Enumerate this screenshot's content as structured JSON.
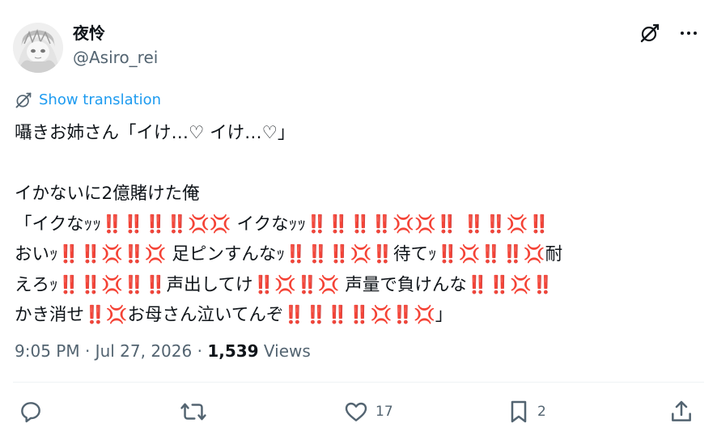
{
  "author": {
    "display_name": "夜怜",
    "handle": "@Asiro_rei"
  },
  "translation": {
    "label": "Show translation"
  },
  "tweet": {
    "lines": [
      "囁きお姉さん「イけ…♡ イけ…♡」",
      "",
      "イかないに2億賭けた俺",
      "「イクなｯｯ‼️‼️‼️‼️💢💢 イクなｯｯ‼️‼️‼️‼️💢💢‼️ ‼️‼️💢‼️",
      "おいｯ‼️‼️💢‼️💢 足ピンすんなｯ‼️‼️‼️💢‼️待てｯ‼️💢‼️‼️💢耐",
      "えろｯ‼️‼️💢‼️‼️声出してけ‼️💢‼️💢 声量で負けんな‼️‼️💢‼️",
      "かき消せ‼️💢お母さん泣いてんぞ‼️‼️‼️‼️💢‼️💢」"
    ]
  },
  "meta": {
    "time": "9:05 PM",
    "sep1": " · ",
    "date": "Jul 27, 2026",
    "sep2": " · ",
    "views_count": "1,539",
    "views_label": " Views"
  },
  "actions": {
    "reply_count": "",
    "repost_count": "",
    "like_count": "17",
    "bookmark_count": "2"
  },
  "icons": {
    "grok": "grok-icon",
    "more": "more-dots-icon",
    "translate": "translate-icon",
    "reply": "reply-icon",
    "repost": "repost-icon",
    "like": "heart-icon",
    "bookmark": "bookmark-icon",
    "share": "share-icon"
  },
  "colors": {
    "text": "#0f1419",
    "secondary": "#536471",
    "link": "#1d9bf0",
    "divider": "#eff3f4",
    "emoji_red": "#d9253a"
  }
}
